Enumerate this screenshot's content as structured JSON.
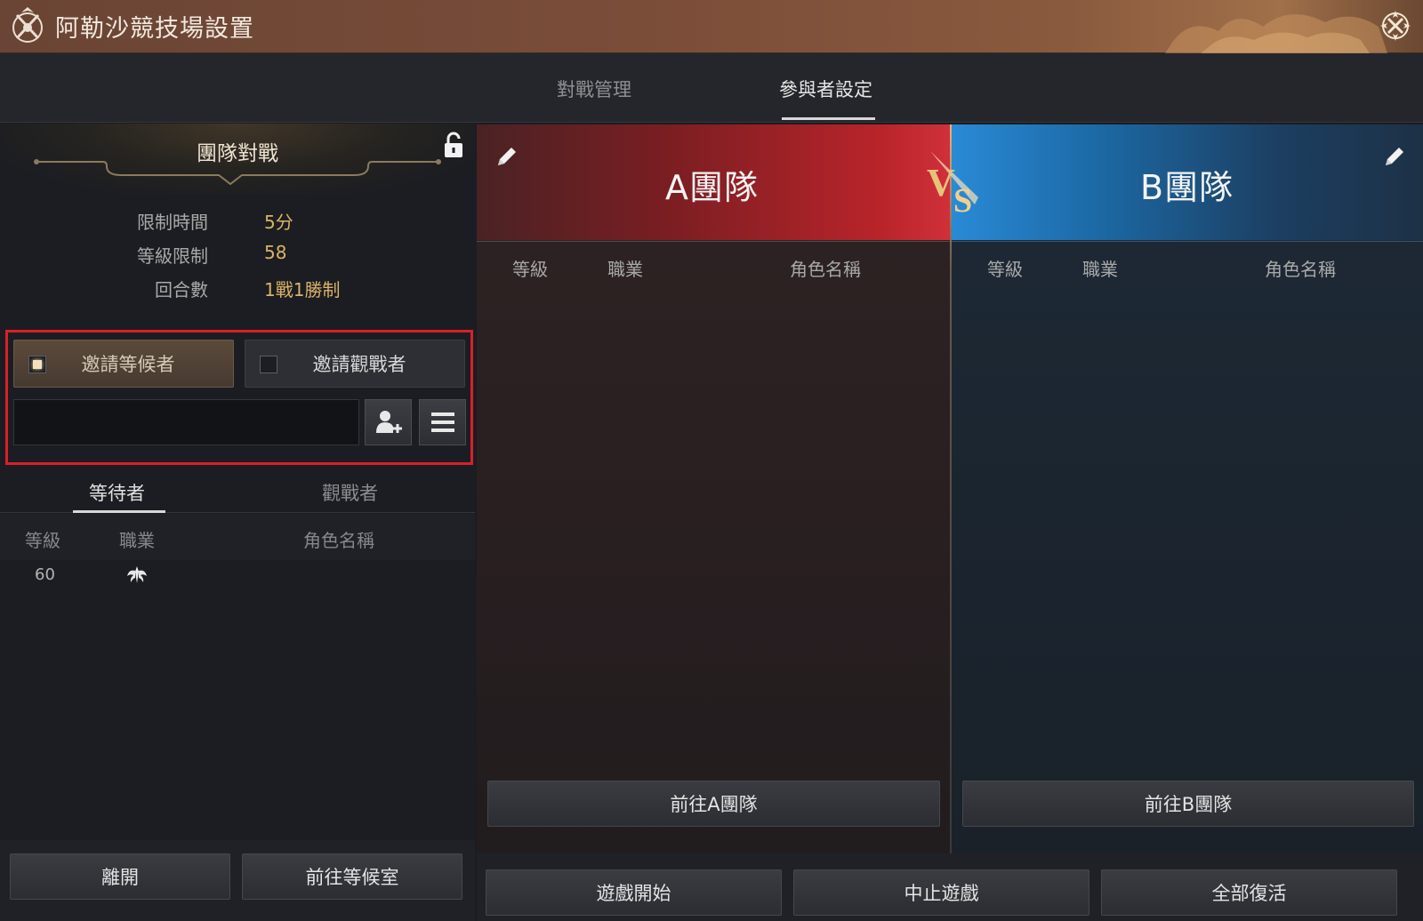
{
  "window": {
    "title": "阿勒沙競技場設置"
  },
  "tabs": [
    {
      "label": "對戰管理",
      "active": false
    },
    {
      "label": "參與者設定",
      "active": true
    }
  ],
  "mode": {
    "title": "團隊對戰",
    "rows": [
      {
        "key": "限制時間",
        "value": "5分"
      },
      {
        "key": "等級限制",
        "value": "58"
      },
      {
        "key": "回合數",
        "value": "1戰1勝制"
      }
    ]
  },
  "invite": {
    "waiting_label": "邀請等候者",
    "waiting_checked": true,
    "spectator_label": "邀請觀戰者",
    "spectator_checked": false,
    "name_value": "",
    "name_placeholder": ""
  },
  "subtabs": [
    {
      "label": "等待者",
      "active": true
    },
    {
      "label": "觀戰者",
      "active": false
    }
  ],
  "waiting_list": {
    "columns": [
      "等級",
      "職業",
      "角色名稱"
    ],
    "rows": [
      {
        "level": "60",
        "class_icon": "winged-class-icon",
        "name": ""
      }
    ]
  },
  "teams": {
    "a": {
      "name": "A團隊",
      "columns": [
        "等級",
        "職業",
        "角色名稱"
      ],
      "goto_label": "前往A團隊",
      "color": "#c0262e"
    },
    "b": {
      "name": "B團隊",
      "columns": [
        "等級",
        "職業",
        "角色名稱"
      ],
      "goto_label": "前往B團隊",
      "color": "#2a86d0"
    }
  },
  "left_footer": {
    "leave_label": "離開",
    "goto_waiting_label": "前往等候室"
  },
  "bottom_bar": {
    "start_label": "遊戲開始",
    "stop_label": "中止遊戲",
    "revive_all_label": "全部復活"
  },
  "colors": {
    "accent_gold": "#d9b466",
    "highlight_red": "#d8202b"
  }
}
